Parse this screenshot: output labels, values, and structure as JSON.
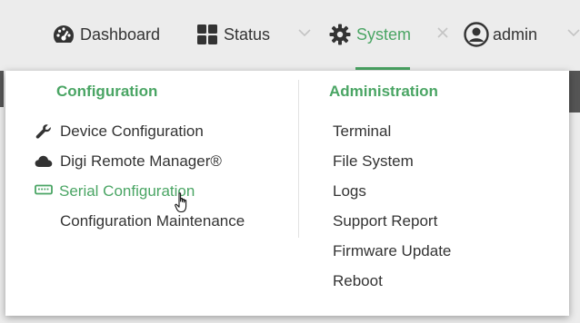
{
  "nav": {
    "items": [
      {
        "label": "Dashboard",
        "icon": "dashboard-gauge-icon"
      },
      {
        "label": "Status",
        "icon": "status-grid-icon"
      },
      {
        "label": "System",
        "icon": "system-gear-icon",
        "active": true
      },
      {
        "label": "admin",
        "icon": "user-avatar-icon"
      }
    ]
  },
  "menu": {
    "configuration": {
      "heading": "Configuration",
      "items": [
        {
          "label": "Device Configuration",
          "icon": "wrench-icon"
        },
        {
          "label": "Digi Remote Manager®",
          "icon": "cloud-icon"
        },
        {
          "label": "Serial Configuration",
          "icon": "serial-port-icon",
          "hover": true
        },
        {
          "label": "Configuration Maintenance"
        }
      ]
    },
    "administration": {
      "heading": "Administration",
      "items": [
        {
          "label": "Terminal"
        },
        {
          "label": "File System"
        },
        {
          "label": "Logs"
        },
        {
          "label": "Support Report"
        },
        {
          "label": "Firmware Update"
        },
        {
          "label": "Reboot"
        }
      ]
    }
  },
  "colors": {
    "accent": "#4aa564",
    "text": "#333333",
    "background": "#ececec"
  }
}
